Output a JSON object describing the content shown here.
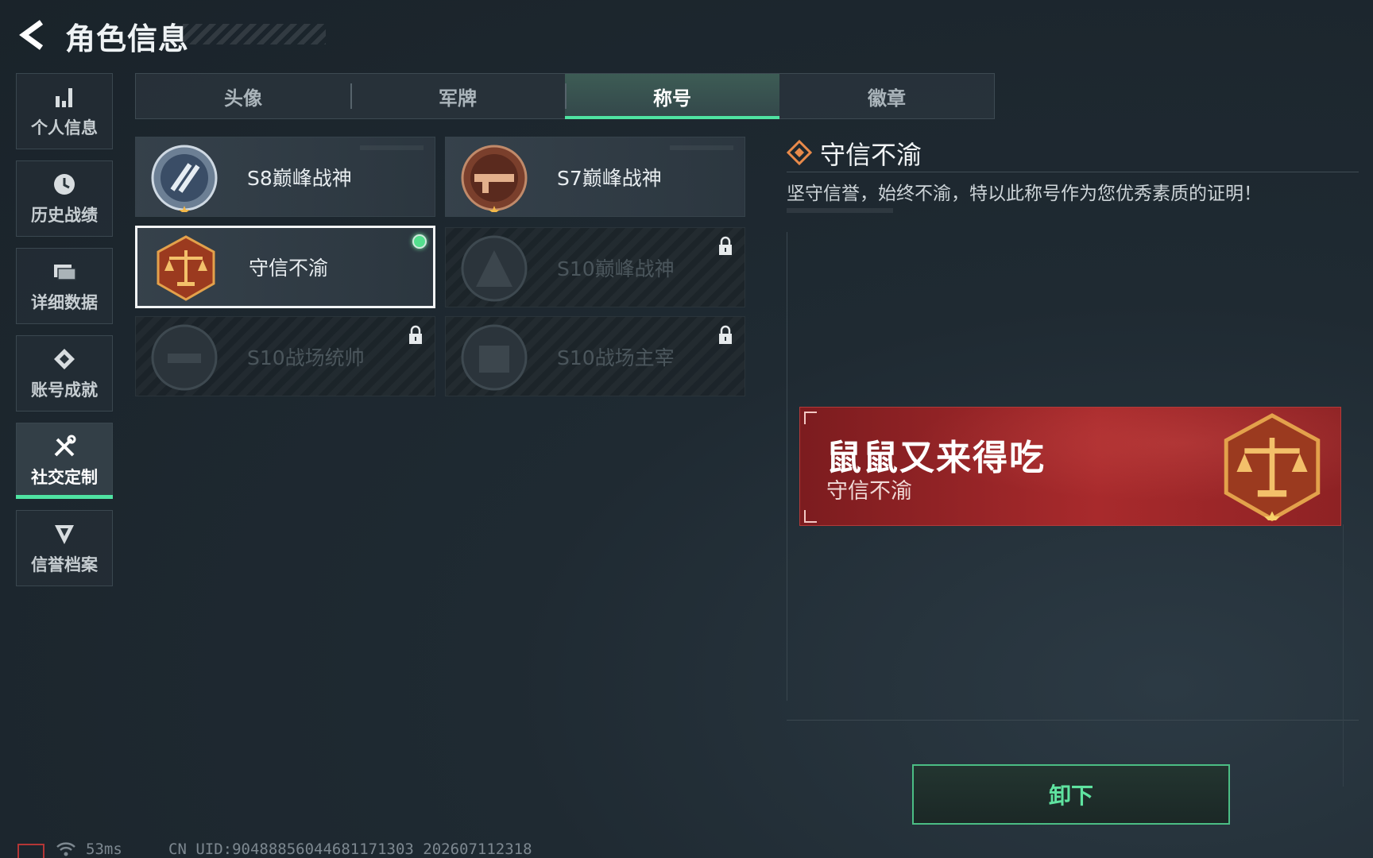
{
  "header": {
    "title": "角色信息"
  },
  "sidebar": {
    "items": [
      {
        "label": "个人信息",
        "icon": "bar-chart-icon",
        "active": false
      },
      {
        "label": "历史战绩",
        "icon": "clock-icon",
        "active": false
      },
      {
        "label": "详细数据",
        "icon": "folder-icon",
        "active": false
      },
      {
        "label": "账号成就",
        "icon": "medal-icon",
        "active": false
      },
      {
        "label": "社交定制",
        "icon": "tools-icon",
        "active": true
      },
      {
        "label": "信誉档案",
        "icon": "shield-badge-icon",
        "active": false
      }
    ]
  },
  "tabs": [
    {
      "label": "头像",
      "active": false
    },
    {
      "label": "军牌",
      "active": false
    },
    {
      "label": "称号",
      "active": true
    },
    {
      "label": "徽章",
      "active": false
    }
  ],
  "titles": [
    {
      "name": "S8巅峰战神",
      "icon": "s8-emblem-icon",
      "locked": false,
      "selected": false,
      "equipped": false
    },
    {
      "name": "S7巅峰战神",
      "icon": "s7-emblem-icon",
      "locked": false,
      "selected": false,
      "equipped": false
    },
    {
      "name": "守信不渝",
      "icon": "scales-emblem-icon",
      "locked": false,
      "selected": true,
      "equipped": true
    },
    {
      "name": "S10巅峰战神",
      "icon": "s10-peak-emblem-icon",
      "locked": true,
      "selected": false,
      "equipped": false
    },
    {
      "name": "S10战场统帅",
      "icon": "s10-commander-emblem-icon",
      "locked": true,
      "selected": false,
      "equipped": false
    },
    {
      "name": "S10战场主宰",
      "icon": "s10-dominator-emblem-icon",
      "locked": true,
      "selected": false,
      "equipped": false
    }
  ],
  "detail": {
    "title": "守信不渝",
    "description": "坚守信誉，始终不渝，特以此称号作为您优秀素质的证明！"
  },
  "banner": {
    "player_name": "鼠鼠又来得吃",
    "title": "守信不渝"
  },
  "actions": {
    "unequip_label": "卸下"
  },
  "footer": {
    "ping": "53ms",
    "uid": "CN UID:9048885604468117130З 202607112318"
  },
  "colors": {
    "accent": "#4fe3a2",
    "banner_red": "#a82a2c",
    "equipped_dot": "#54e08e"
  }
}
